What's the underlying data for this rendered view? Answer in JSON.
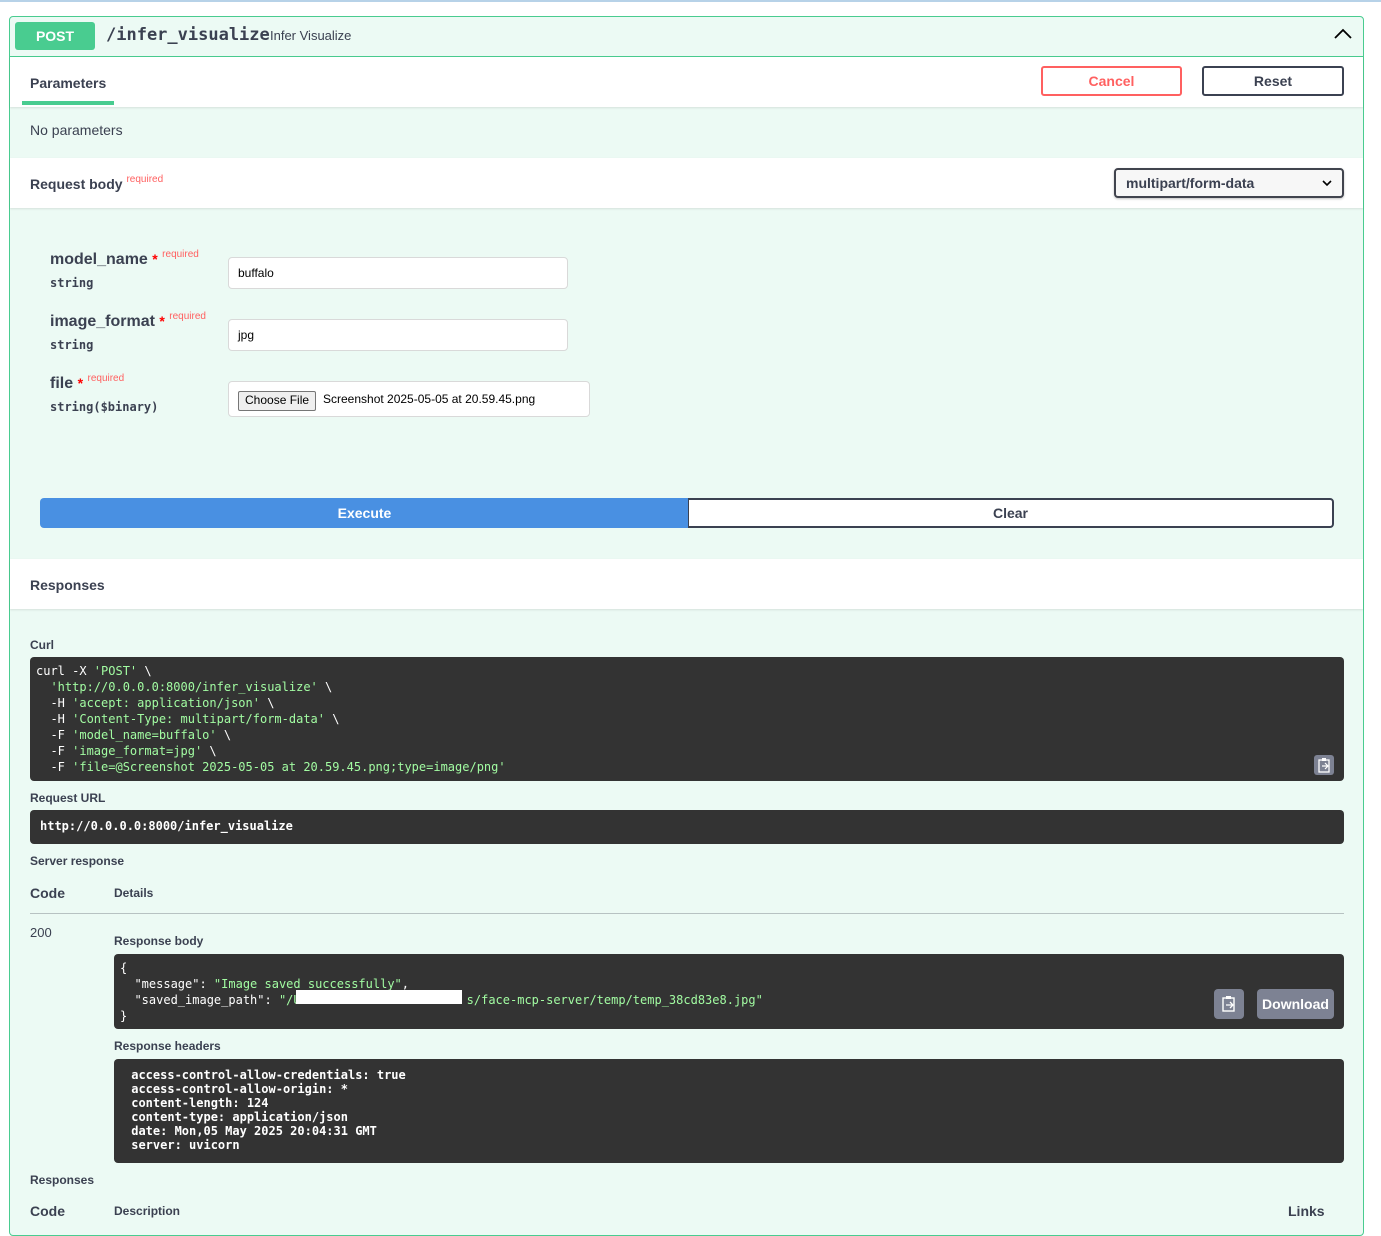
{
  "operation": {
    "method": "POST",
    "path": "/infer_visualize",
    "summary": "Infer Visualize"
  },
  "parameters": {
    "tab_label": "Parameters",
    "cancel_label": "Cancel",
    "reset_label": "Reset",
    "empty_text": "No parameters"
  },
  "request_body": {
    "title": "Request body",
    "required_tag": "required",
    "content_type": "multipart/form-data",
    "fields": [
      {
        "name": "model_name",
        "star": "*",
        "required": "required",
        "type": "string",
        "value": "buffalo"
      },
      {
        "name": "image_format",
        "star": "*",
        "required": "required",
        "type": "string",
        "value": "jpg"
      },
      {
        "name": "file",
        "star": "*",
        "required": "required",
        "type": "string($binary)",
        "button": "Choose File",
        "value": "Screenshot 2025-05-05 at 20.59.45.png"
      }
    ]
  },
  "actions": {
    "execute_label": "Execute",
    "clear_label": "Clear"
  },
  "responses_header": "Responses",
  "curl": {
    "label": "Curl",
    "lines": [
      [
        "curl -X ",
        "'POST'",
        " \\"
      ],
      [
        "  ",
        "'http://0.0.0.0:8000/infer_visualize'",
        " \\"
      ],
      [
        "  -H ",
        "'accept: application/json'",
        " \\"
      ],
      [
        "  -H ",
        "'Content-Type: multipart/form-data'",
        " \\"
      ],
      [
        "  -F ",
        "'model_name=buffalo'",
        " \\"
      ],
      [
        "  -F ",
        "'image_format=jpg'",
        " \\"
      ],
      [
        "  -F ",
        "'file=@Screenshot 2025-05-05 at 20.59.45.png;type=image/png'",
        ""
      ]
    ]
  },
  "request_url": {
    "label": "Request URL",
    "value": "http://0.0.0.0:8000/infer_visualize"
  },
  "server_response": {
    "label": "Server response",
    "code_header": "Code",
    "details_header": "Details",
    "code": "200",
    "body_label": "Response body",
    "body_lines": [
      [
        "{",
        "",
        "",
        ""
      ],
      [
        "  \"message\": ",
        "\"Image saved successfully\"",
        ",",
        ""
      ],
      [
        "  \"saved_image_path\": ",
        "\"/U",
        "",
        "s/face-mcp-server/temp/temp_38cd83e8.jpg\""
      ],
      [
        "}",
        "",
        "",
        ""
      ]
    ],
    "download_label": "Download",
    "headers_label": "Response headers",
    "headers_lines": [
      " access-control-allow-credentials: true ",
      " access-control-allow-origin: * ",
      " content-length: 124 ",
      " content-type: application/json ",
      " date: Mon,05 May 2025 20:04:31 GMT ",
      " server: uvicorn "
    ]
  },
  "responses_footer": {
    "label": "Responses",
    "code_header": "Code",
    "description_header": "Description",
    "links_header": "Links"
  }
}
